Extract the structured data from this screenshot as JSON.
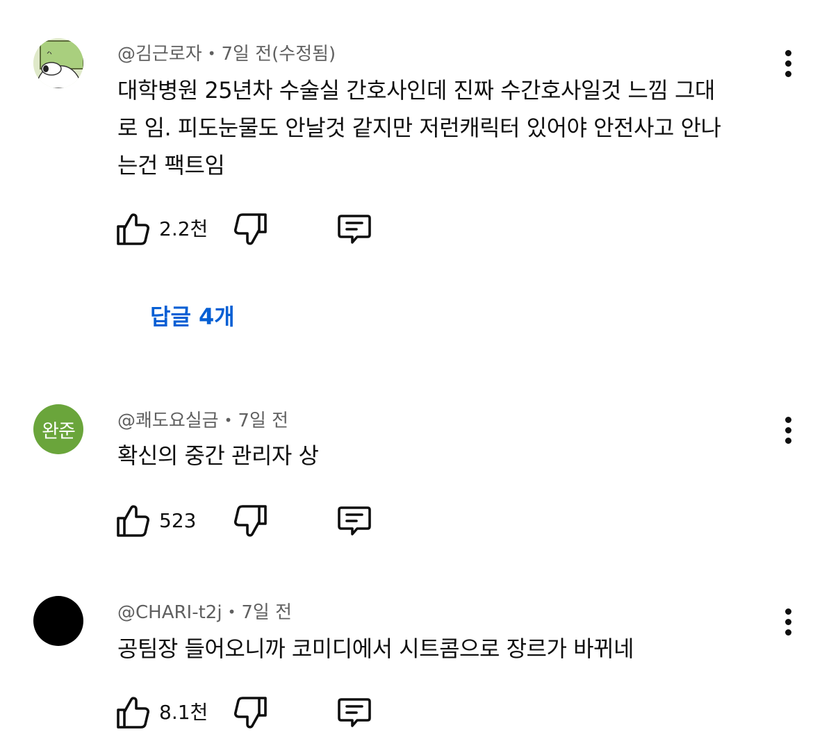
{
  "comments": [
    {
      "author": "@김근로자",
      "time": "7일 전(수정됨)",
      "separator": "•",
      "lines": [
        "대학병원 25년차 수술실 간호사인데 진짜 수간호사일것  느낌 그대",
        "로 임. 피도눈물도 안날것 같지만 저런캐릭터 있어야 안전사고 안나",
        "는건 팩트임"
      ],
      "likes": "2.2천",
      "replies_label": "답글 4개",
      "avatar_icon": "cartoon-character-avatar"
    },
    {
      "author": "@쾌도요실금",
      "time": "7일 전",
      "separator": "•",
      "lines": [
        "확신의 중간 관리자 상"
      ],
      "likes": "523",
      "avatar_initials": "완준",
      "avatar_color": "#6aa53b"
    },
    {
      "author": "@CHARI-t2j",
      "time": "7일 전",
      "separator": "•",
      "lines": [
        "공팀장 들어오니까 코미디에서 시트콤으로 장르가 바뀌네"
      ],
      "likes": "8.1천",
      "avatar_color": "#000000"
    }
  ],
  "icons": {
    "like": "thumbs-up-icon",
    "dislike": "thumbs-down-icon",
    "reply": "reply-comment-icon",
    "more": "more-vertical-icon"
  },
  "colors": {
    "link": "#065fd4",
    "meta": "#606060",
    "text": "#0f0f0f"
  }
}
